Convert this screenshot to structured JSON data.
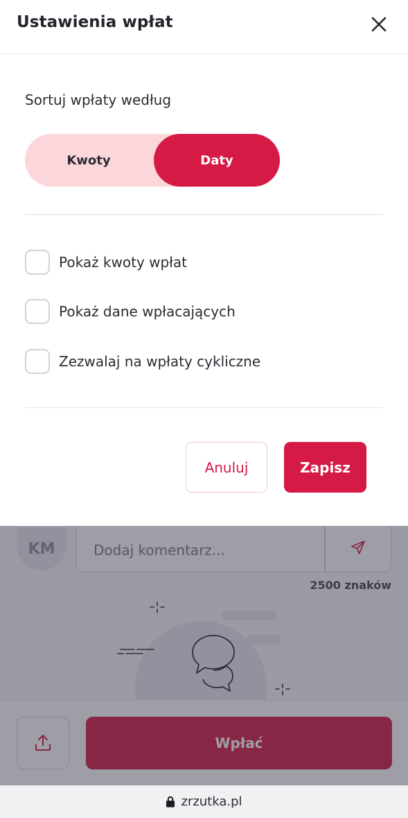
{
  "modal": {
    "title": "Ustawienia wpłat",
    "close_icon": "close-icon",
    "sort_label": "Sortuj wpłaty według",
    "sort_options": [
      {
        "label": "Kwoty",
        "selected": false
      },
      {
        "label": "Daty",
        "selected": true
      }
    ],
    "options": [
      {
        "label": "Pokaż kwoty wpłat",
        "checked": false
      },
      {
        "label": "Pokaż dane wpłacających",
        "checked": false
      },
      {
        "label": "Zezwalaj na wpłaty cykliczne",
        "checked": false
      }
    ],
    "cancel_label": "Anuluj",
    "save_label": "Zapisz"
  },
  "comments": {
    "avatar_initials": "KM",
    "input_placeholder": "Dodaj komentarz...",
    "send_icon": "send-icon",
    "char_limit": "2500 znaków"
  },
  "footer": {
    "share_icon": "share-icon",
    "pay_label": "Wpłać"
  },
  "browser": {
    "url": "zrzutka.pl",
    "lock_icon": "lock-icon"
  },
  "colors": {
    "accent": "#d51a45",
    "toggle_bg": "#fbd7dc",
    "overlay": "#343448"
  }
}
